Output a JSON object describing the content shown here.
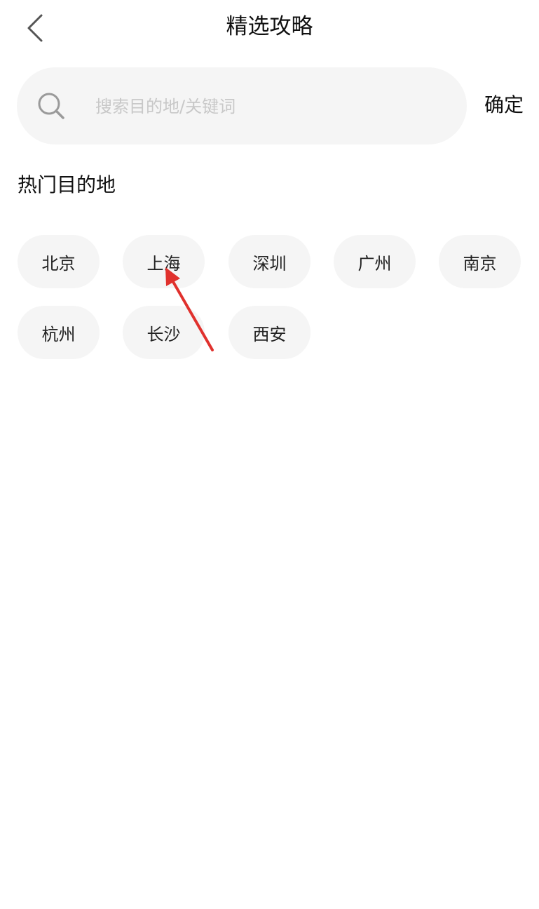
{
  "header": {
    "title": "精选攻略",
    "back_icon": "chevron-left-icon"
  },
  "search": {
    "placeholder": "搜索目的地/关键词",
    "value": "",
    "icon": "search-icon",
    "confirm_label": "确定"
  },
  "hot": {
    "title": "热门目的地",
    "destinations": [
      "北京",
      "上海",
      "深圳",
      "广州",
      "南京",
      "杭州",
      "长沙",
      "西安"
    ]
  },
  "colors": {
    "chip_bg": "#f5f5f5",
    "annotation_arrow": "#e0312d"
  }
}
